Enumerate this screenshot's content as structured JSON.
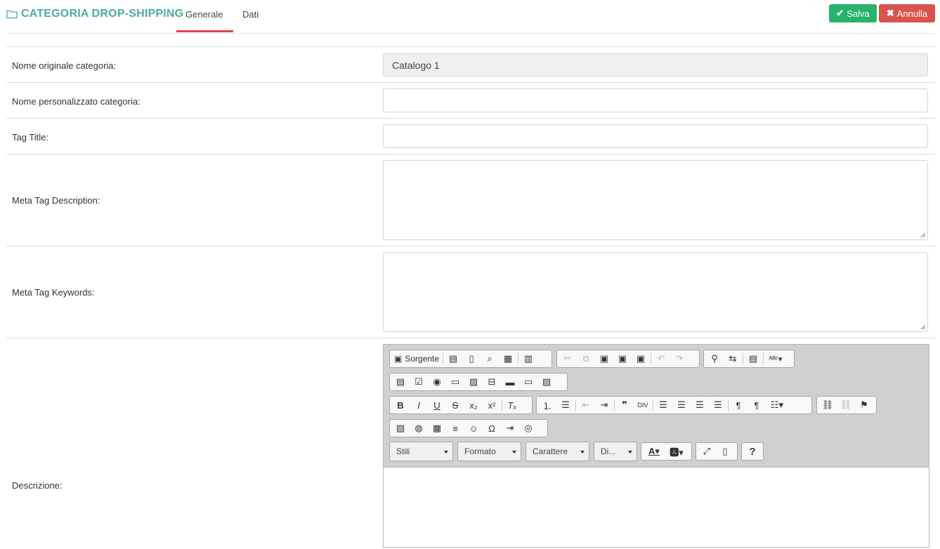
{
  "header": {
    "title": "CATEGORIA DROP-SHIPPING",
    "tabs": [
      {
        "label": "Generale",
        "active": true
      },
      {
        "label": "Dati",
        "active": false
      }
    ],
    "save_label": "Salva",
    "cancel_label": "Annulla"
  },
  "colors": {
    "accent": "#4eab9b",
    "tab_underline": "#e0464d",
    "save": "#26b36b",
    "cancel": "#d9534f"
  },
  "form": {
    "original_name_label": "Nome originale categoria:",
    "original_name_value": "Catalogo 1",
    "custom_name_label": "Nome personalizzato categoria:",
    "custom_name_value": "",
    "tag_title_label": "Tag Title:",
    "tag_title_value": "",
    "meta_description_label": "Meta Tag Description:",
    "meta_description_value": "",
    "meta_keywords_label": "Meta Tag Keywords:",
    "meta_keywords_value": "",
    "description_label": "Descrizione:"
  },
  "editor": {
    "source_label": "Sorgente",
    "styles_label": "Stili",
    "format_label": "Formato",
    "font_label": "Carattere",
    "size_label": "Di...",
    "help_label": "?"
  }
}
